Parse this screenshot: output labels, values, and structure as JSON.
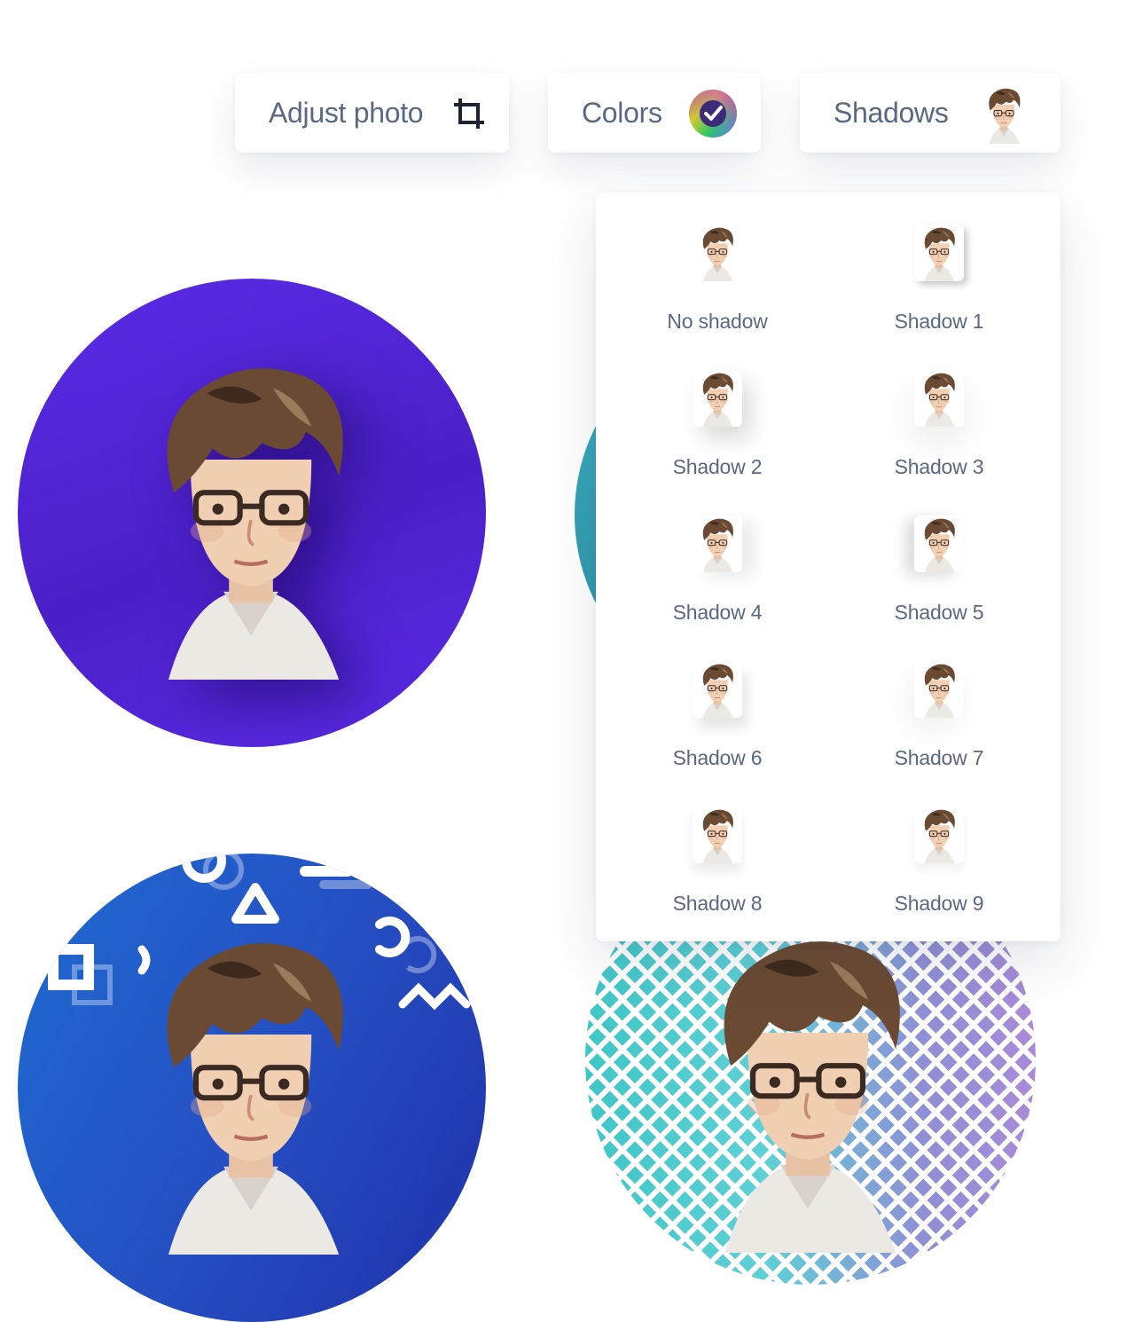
{
  "toolbar": {
    "adjust_label": "Adjust photo",
    "adjust_icon": "crop-icon",
    "colors_label": "Colors",
    "colors_icon": "color-wheel-check-icon",
    "shadows_label": "Shadows",
    "shadows_icon": "avatar-thumbnail-icon"
  },
  "shadow_menu": {
    "options": [
      {
        "label": "No shadow"
      },
      {
        "label": "Shadow 1"
      },
      {
        "label": "Shadow 2"
      },
      {
        "label": "Shadow 3"
      },
      {
        "label": "Shadow 4"
      },
      {
        "label": "Shadow 5"
      },
      {
        "label": "Shadow 6"
      },
      {
        "label": "Shadow 7"
      },
      {
        "label": "Shadow 8"
      },
      {
        "label": "Shadow 9"
      }
    ]
  },
  "previews": {
    "purple_bg": "#5a2be6",
    "teal_bg": "#3fb1c2",
    "blue_bg": "#2550c4",
    "diamond_bg": "#5fd0d6"
  },
  "colors": {
    "text": "#5b6882",
    "icon_dark": "#1f2233",
    "check": "#ffffff"
  }
}
